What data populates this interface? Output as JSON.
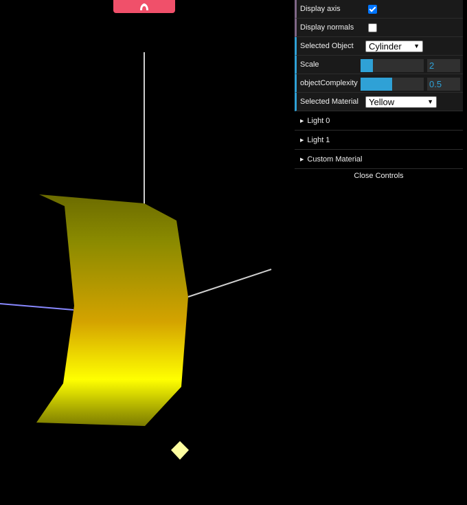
{
  "gui": {
    "display_axis": {
      "label": "Display axis",
      "checked": true
    },
    "display_normals": {
      "label": "Display normals",
      "checked": false
    },
    "selected_object": {
      "label": "Selected Object",
      "value": "Cylinder"
    },
    "scale": {
      "label": "Scale",
      "value": "2",
      "fraction": 0.2
    },
    "object_complexity": {
      "label": "objectComplexity",
      "value": "0.5",
      "fraction": 0.5
    },
    "selected_material": {
      "label": "Selected Material",
      "value": "Yellow"
    },
    "folders": [
      "Light 0",
      "Light 1",
      "Custom Material"
    ],
    "close_label": "Close Controls"
  },
  "colors": {
    "panel_bg": "#1a1a1a",
    "bool_accent": "#806787",
    "number_accent": "#2fa1d6",
    "top_tab": "#f0506a",
    "object_yellow": "#ffff00"
  },
  "icons": {
    "top_tab": "stats-icon",
    "folder": "triangle-right-icon"
  }
}
